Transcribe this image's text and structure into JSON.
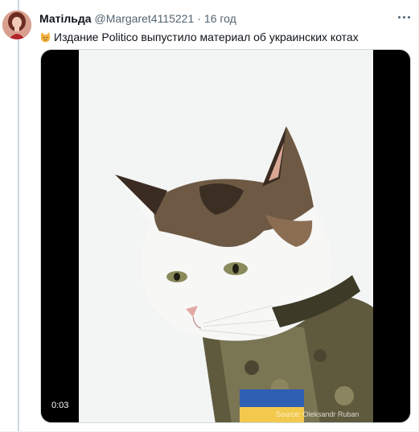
{
  "tweet": {
    "author_name": "Матільда",
    "handle": "@Margaret4115221",
    "separator": "·",
    "time": "16 год",
    "text": "Издание Politico выпустило материал об украинских котах",
    "emoji_icon": "cat-face-emoji"
  },
  "media": {
    "type": "video",
    "duration": "0:03",
    "watermark": "Source: Oleksandr Ruban"
  },
  "colors": {
    "text_primary": "#0f1419",
    "text_secondary": "#536471",
    "border": "#cfd9de"
  }
}
